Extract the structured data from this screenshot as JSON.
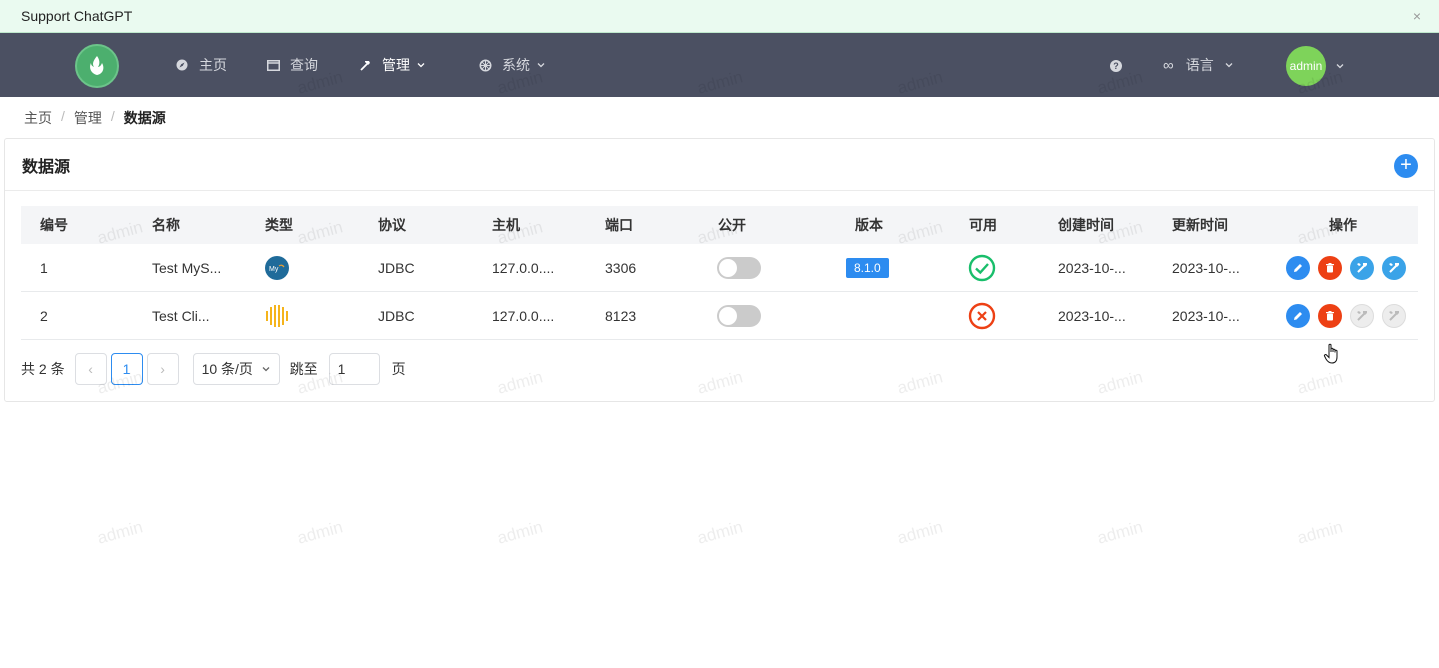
{
  "notice": {
    "text": "Support ChatGPT",
    "close": "×"
  },
  "header": {
    "nav": [
      {
        "label": "主页",
        "icon": "compass-icon"
      },
      {
        "label": "查询",
        "icon": "window-icon"
      },
      {
        "label": "管理",
        "icon": "hammer-icon",
        "active": true,
        "dropdown": true
      },
      {
        "label": "系统",
        "icon": "gear-icon",
        "dropdown": true
      }
    ],
    "help": "?",
    "language_icon": "∞",
    "language": "语言",
    "user": "admin"
  },
  "breadcrumb": [
    "主页",
    "管理",
    "数据源"
  ],
  "card": {
    "title": "数据源",
    "add_label": "+"
  },
  "table": {
    "columns": [
      "编号",
      "名称",
      "类型",
      "协议",
      "主机",
      "端口",
      "公开",
      "版本",
      "可用",
      "创建时间",
      "更新时间",
      "操作"
    ],
    "rows": [
      {
        "id": "1",
        "name": "Test MyS...",
        "type_icon": "mysql-icon",
        "protocol": "JDBC",
        "host": "127.0.0....",
        "port": "3306",
        "public": false,
        "version": "8.1.0",
        "available": true,
        "created": "2023-10-...",
        "updated": "2023-10-...",
        "tools_enabled": true
      },
      {
        "id": "2",
        "name": "Test Cli...",
        "type_icon": "clickhouse-icon",
        "protocol": "JDBC",
        "host": "127.0.0....",
        "port": "8123",
        "public": false,
        "version": "",
        "available": false,
        "created": "2023-10-...",
        "updated": "2023-10-...",
        "tools_enabled": false
      }
    ]
  },
  "pagination": {
    "total": "共 2 条",
    "prev": "‹",
    "page": "1",
    "next": "›",
    "page_size": "10 条/页",
    "jump_label": "跳至",
    "jump_value": "1",
    "jump_suffix": "页"
  },
  "watermark": "admin",
  "colors": {
    "header_bg": "#4b5062",
    "primary": "#2d8cf0",
    "danger": "#ed4014",
    "success": "#19be6b",
    "notice_bg": "#eafaf0"
  }
}
